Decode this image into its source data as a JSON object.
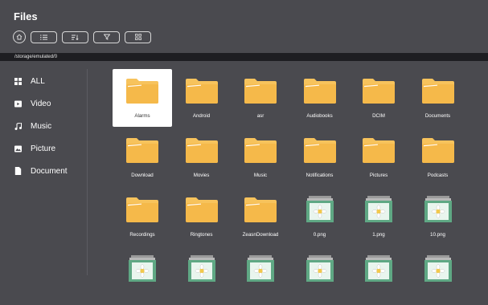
{
  "app": {
    "title": "Files"
  },
  "toolbar": {
    "buttons": [
      {
        "icon": "home-icon"
      },
      {
        "icon": "list-view-icon"
      },
      {
        "icon": "sort-icon"
      },
      {
        "icon": "filter-icon"
      },
      {
        "icon": "grid-view-icon"
      }
    ]
  },
  "path": {
    "current": "/storage/emulated/0"
  },
  "sidebar": {
    "items": [
      {
        "label": "ALL",
        "icon": "grid-icon"
      },
      {
        "label": "Video",
        "icon": "video-icon"
      },
      {
        "label": "Music",
        "icon": "music-note-icon"
      },
      {
        "label": "Picture",
        "icon": "picture-icon"
      },
      {
        "label": "Document",
        "icon": "document-icon"
      }
    ]
  },
  "files": [
    {
      "name": "Alarms",
      "type": "folder",
      "selected": true
    },
    {
      "name": "Android",
      "type": "folder"
    },
    {
      "name": "asr",
      "type": "folder"
    },
    {
      "name": "Audiobooks",
      "type": "folder"
    },
    {
      "name": "DCIM",
      "type": "folder"
    },
    {
      "name": "Documents",
      "type": "folder"
    },
    {
      "name": "Download",
      "type": "folder"
    },
    {
      "name": "Movies",
      "type": "folder"
    },
    {
      "name": "Music",
      "type": "folder"
    },
    {
      "name": "Notifications",
      "type": "folder"
    },
    {
      "name": "Pictures",
      "type": "folder"
    },
    {
      "name": "Podcasts",
      "type": "folder"
    },
    {
      "name": "Recordings",
      "type": "folder"
    },
    {
      "name": "Ringtones",
      "type": "folder"
    },
    {
      "name": "ZeasnDownload",
      "type": "folder"
    },
    {
      "name": "0.png",
      "type": "image"
    },
    {
      "name": "1.png",
      "type": "image"
    },
    {
      "name": "10.png",
      "type": "image"
    },
    {
      "name": "",
      "type": "image"
    },
    {
      "name": "",
      "type": "image"
    },
    {
      "name": "",
      "type": "image"
    },
    {
      "name": "",
      "type": "image"
    },
    {
      "name": "",
      "type": "image"
    },
    {
      "name": "",
      "type": "image"
    }
  ],
  "colors": {
    "background": "#4a4a4f",
    "path_bar": "#1e1e22",
    "folder": "#f5b94a",
    "folder_tab": "#f7c35c",
    "image_frame": "#5fa884",
    "selected": "#ffffff"
  }
}
